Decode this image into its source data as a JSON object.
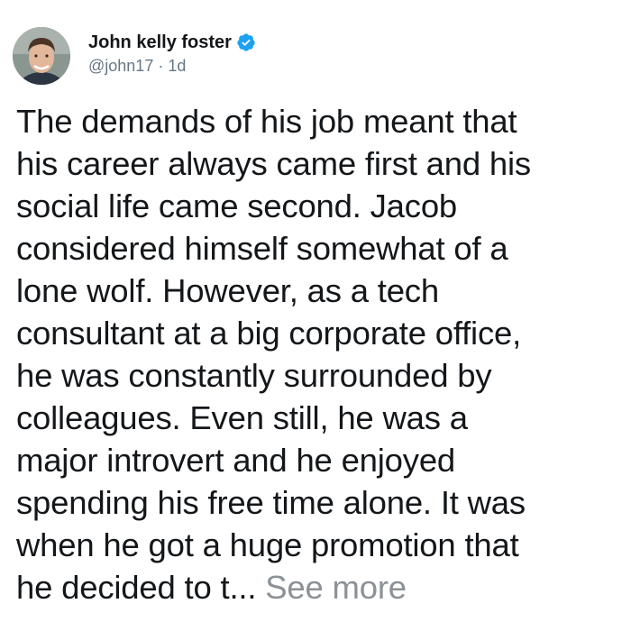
{
  "author": {
    "display_name": "John kelly foster",
    "handle": "@john17",
    "separator": "·",
    "time": "1d",
    "verified_icon": "verified-badge-icon",
    "verified_color": "#1da1f2"
  },
  "tweet": {
    "lines": [
      "The demands of his job meant that",
      "his career always came first and his",
      "social life came second. Jacob",
      "considered himself somewhat of a",
      "lone wolf. However, as a tech",
      "consultant at a big corporate office,",
      "he was constantly surrounded by",
      "colleagues. Even still, he was a",
      "major introvert and he enjoyed",
      "spending his free time alone. It was",
      "when he got a huge promotion that",
      "he decided to t..."
    ],
    "see_more_label": "See more"
  },
  "colors": {
    "text": "#14171a",
    "muted": "#657786",
    "see_more": "#8c9196"
  }
}
